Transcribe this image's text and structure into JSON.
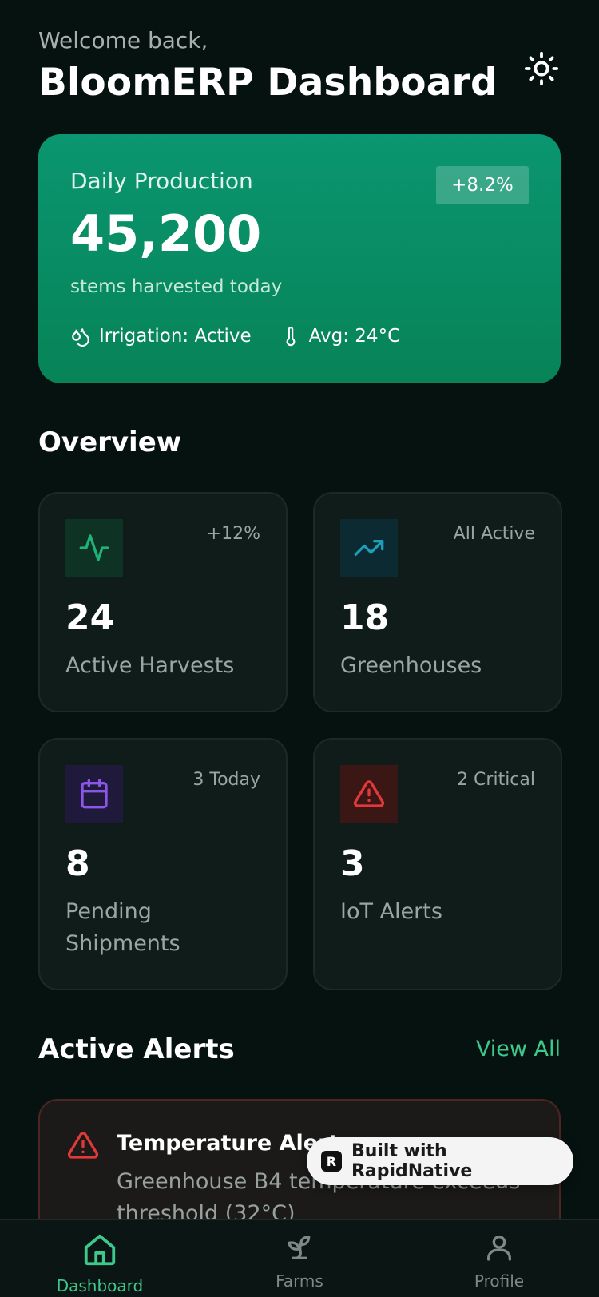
{
  "header": {
    "welcome": "Welcome back,",
    "title": "BloomERP Dashboard",
    "theme_icon": "sun-icon"
  },
  "hero": {
    "label": "Daily Production",
    "badge": "+8.2%",
    "value": "45,200",
    "subtitle": "stems harvested today",
    "irrigation": "Irrigation: Active",
    "temperature": "Avg: 24°C"
  },
  "overview": {
    "title": "Overview",
    "cards": [
      {
        "value": "24",
        "label": "Active Harvests",
        "corner": "+12%",
        "icon": "activity-icon",
        "accent": "#1fb37a"
      },
      {
        "value": "18",
        "label": "Greenhouses",
        "corner": "All Active",
        "icon": "trending-up-icon",
        "accent": "#1c9fb8"
      },
      {
        "value": "8",
        "label": "Pending Shipments",
        "corner": "3 Today",
        "icon": "calendar-icon",
        "accent": "#8b55e8"
      },
      {
        "value": "3",
        "label": "IoT Alerts",
        "corner": "2 Critical",
        "icon": "alert-triangle-icon",
        "accent": "#e2383a"
      }
    ]
  },
  "alerts": {
    "title": "Active Alerts",
    "view_all": "View All",
    "items": [
      {
        "title": "Temperature Alert",
        "body": "Greenhouse B4 temperature exceeds threshold (32°C)"
      }
    ]
  },
  "badge": {
    "text": "Built with RapidNative"
  },
  "nav": {
    "items": [
      {
        "label": "Dashboard",
        "icon": "home-icon",
        "active": true
      },
      {
        "label": "Farms",
        "icon": "sprout-icon",
        "active": false
      },
      {
        "label": "Profile",
        "icon": "user-icon",
        "active": false
      }
    ]
  },
  "colors": {
    "background": "#061210",
    "accent": "#3ec98c",
    "hero": "#0a9670",
    "card": "#0f1c1a",
    "alert_border": "#4d2523"
  }
}
